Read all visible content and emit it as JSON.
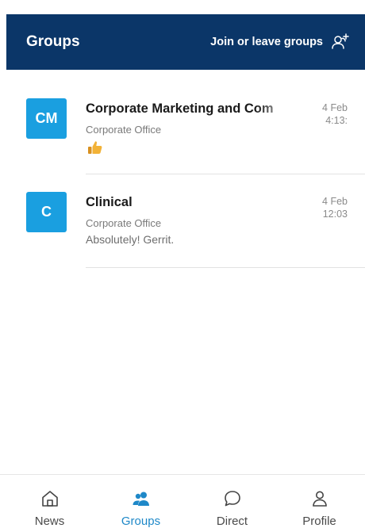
{
  "header": {
    "title": "Groups",
    "join_label": "Join or leave groups",
    "join_icon": "person-add-icon",
    "bg_color": "#0b3668"
  },
  "groups": [
    {
      "initials": "CM",
      "name": "Corporate Marketing and Com",
      "location": "Corporate Office",
      "preview": "",
      "preview_icon": "thumbs-up-icon",
      "date": "4 Feb",
      "time": "4:13:",
      "avatar_color": "#1a9fe0"
    },
    {
      "initials": "C",
      "name": "Clinical",
      "location": "Corporate Office",
      "preview": "Absolutely! Gerrit.",
      "date": "4 Feb",
      "time": "12:03",
      "avatar_color": "#1a9fe0"
    }
  ],
  "nav": {
    "active": "Groups",
    "accent_color": "#1e88c8",
    "items": [
      {
        "label": "News",
        "icon": "home-icon"
      },
      {
        "label": "Groups",
        "icon": "groups-icon"
      },
      {
        "label": "Direct",
        "icon": "chat-bubble-icon"
      },
      {
        "label": "Profile",
        "icon": "person-icon"
      }
    ]
  }
}
